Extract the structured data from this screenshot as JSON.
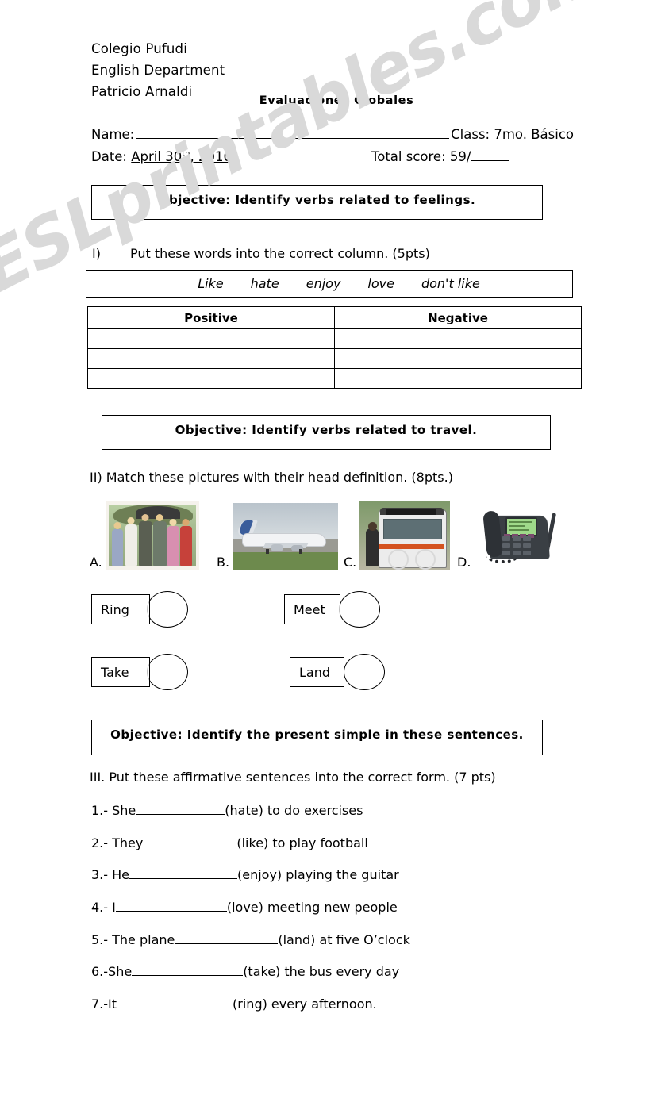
{
  "header": {
    "school": "Colegio Pufudi",
    "department": "English Department",
    "teacher": "Patricio Arnaldi",
    "title": "Evaluaciones Globales"
  },
  "id_fields": {
    "name_label": "Name:",
    "class_label": "Class:",
    "class_value": "7mo. Básico",
    "date_label": "Date:",
    "date_value_month_day": "April 30",
    "date_value_ordinal": "th",
    "date_value_year": ", 2010",
    "score_label": "Total score:",
    "score_value": "59/"
  },
  "objectives": {
    "one": "Objective: Identify verbs related to feelings.",
    "two": "Objective: Identify verbs related to travel.",
    "three": "Objective: Identify the present simple in these sentences."
  },
  "section1": {
    "number": "I)",
    "instruction": "Put these words into the correct column. (5pts)",
    "word_bank": [
      "Like",
      "hate",
      "enjoy",
      "love",
      "don't like"
    ],
    "table": {
      "headers": [
        "Positive",
        "Negative"
      ],
      "rows": [
        [
          "",
          ""
        ],
        [
          "",
          ""
        ],
        [
          "",
          ""
        ]
      ]
    }
  },
  "section2": {
    "instruction": "II) Match these pictures with their head definition. (8pts.)",
    "pictures": [
      {
        "label": "A.",
        "alt": "family-group-photo"
      },
      {
        "label": "B.",
        "alt": "airplane-landing-photo"
      },
      {
        "label": "C.",
        "alt": "bus-boarding-photo"
      },
      {
        "label": "D.",
        "alt": "telephone-photo"
      }
    ],
    "options": [
      {
        "label": "Ring"
      },
      {
        "label": "Meet"
      },
      {
        "label": "Take"
      },
      {
        "label": "Land"
      }
    ]
  },
  "section3": {
    "instruction": "III. Put these affirmative sentences into the correct form. (7 pts)",
    "sentences": [
      {
        "prefix": "1.- She",
        "blank_width": 112,
        "suffix": "(hate) to do exercises"
      },
      {
        "prefix": "2.- They ",
        "blank_width": 118,
        "suffix": "(like) to play football"
      },
      {
        "prefix": "3.- He ",
        "blank_width": 136,
        "suffix": "(enjoy) playing the guitar"
      },
      {
        "prefix": "4.- I",
        "blank_width": 140,
        "suffix": "(love) meeting new people"
      },
      {
        "prefix": "5.- The plane ",
        "blank_width": 130,
        "suffix": "(land) at five O’clock"
      },
      {
        "prefix": "6.-She ",
        "blank_width": 140,
        "suffix": "(take) the bus every day"
      },
      {
        "prefix": "7.-It",
        "blank_width": 146,
        "suffix": "(ring) every afternoon."
      }
    ]
  },
  "watermark": {
    "text": "ESLprintables.com",
    "color": "#d9d9d9"
  }
}
